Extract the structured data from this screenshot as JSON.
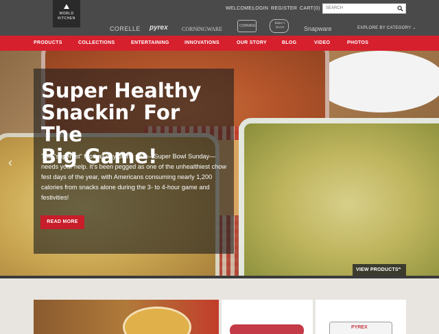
{
  "header": {
    "logo_line1": "WORLD",
    "logo_line2": "KITCHEN",
    "welcome": "WELCOME:",
    "login": "LOGIN",
    "register": "REGISTER",
    "cart": "CART(0)",
    "search_placeholder": "SEARCH",
    "brands": [
      "CORELLE",
      "pyrex",
      "CORNINGWARE",
      "CORNING",
      "Baker's Secret",
      "Snapware"
    ],
    "explore": "EXPLORE BY CATEGORY"
  },
  "nav": [
    "PRODUCTS",
    "COLLECTIONS",
    "ENTERTAINING",
    "INNOVATIONS",
    "OUR STORY",
    "BLOG",
    "VIDEO",
    "PHOTOS"
  ],
  "hero": {
    "headline_lines": [
      "Super Healthy",
      "Snackin’ For The",
      "Big Game!"
    ],
    "body": "The “superest” football day of the year—Super Bowl Sunday—needs your help. It’s been pegged as one of the unhealthiest chow fest days of the year, with Americans consuming nearly 1,200 calories from snacks alone during the 3- to 4-hour game and festivities!",
    "read_more": "READ MORE",
    "view_products": "VIEW PRODUCTS"
  },
  "cards": {
    "pyrex_label": "PYREX"
  },
  "colors": {
    "header_bg": "#4a4a4a",
    "nav_red": "#d6202e",
    "button_red": "#c81d2a"
  }
}
